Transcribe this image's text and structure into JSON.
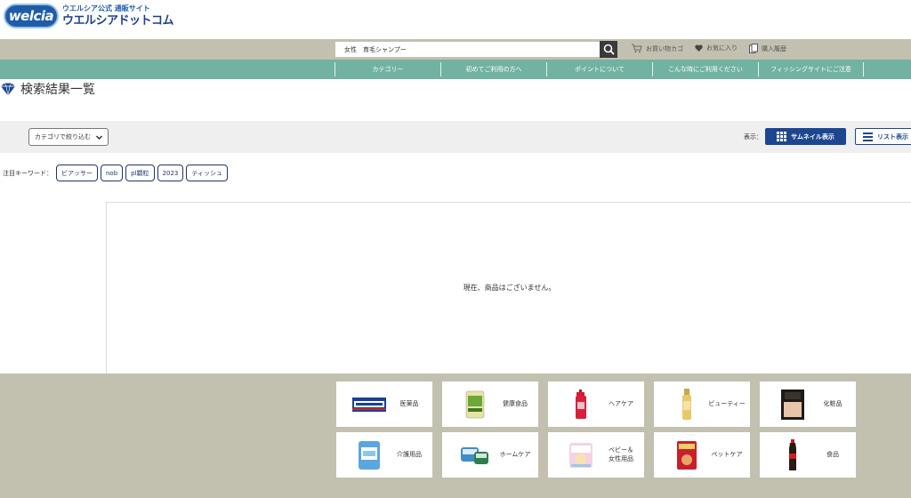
{
  "header": {
    "logo_badge": "welcia",
    "logo_sub": "ウエルシア公式 通販サイト",
    "logo_main": "ウエルシアドットコム"
  },
  "search": {
    "value": "女性　育毛シャンプー"
  },
  "util": {
    "cart": "お買い物カゴ",
    "favorites": "お気に入り",
    "history": "購入履歴"
  },
  "nav": {
    "items": [
      {
        "label": "カテゴリー"
      },
      {
        "label": "初めてご利用の方へ"
      },
      {
        "label": "ポイントについて"
      },
      {
        "label": "こんな時にご利用ください"
      },
      {
        "label": "フィッシングサイトにご注意"
      }
    ]
  },
  "page_title": "検索結果一覧",
  "filter": {
    "category_select": "カテゴリで絞り込む",
    "display_label": "表示：",
    "thumbnail_btn": "サムネイル表示",
    "list_btn": "リスト表示"
  },
  "keywords": {
    "label": "注目キーワード：",
    "chips": [
      "ビアッサー",
      "nob",
      "pl顆粒",
      "2023",
      "ティッシュ"
    ]
  },
  "results": {
    "empty_message": "現在、商品はございません。"
  },
  "categories": [
    {
      "label": "医薬品",
      "icon": "medicine-product-icon"
    },
    {
      "label": "健康食品",
      "icon": "health-food-product-icon"
    },
    {
      "label": "ヘアケア",
      "icon": "haircare-product-icon"
    },
    {
      "label": "ビューティー",
      "icon": "beauty-product-icon"
    },
    {
      "label": "化粧品",
      "icon": "cosmetics-product-icon"
    },
    {
      "label": "介護用品",
      "icon": "care-product-icon"
    },
    {
      "label": "ホームケア",
      "icon": "homecare-product-icon"
    },
    {
      "label": "ベビー＆\n女性用品",
      "icon": "baby-product-icon"
    },
    {
      "label": "ペットケア",
      "icon": "petcare-product-icon"
    },
    {
      "label": "食品",
      "icon": "food-product-icon"
    }
  ],
  "colors": {
    "brand_blue": "#1d4690",
    "nav_teal": "#72b2a3",
    "band_khaki": "#c2c1b0"
  }
}
